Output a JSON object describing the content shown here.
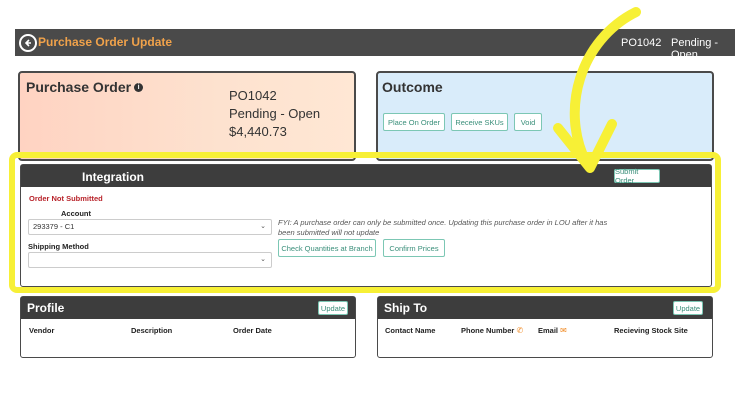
{
  "header": {
    "title": "Purchase Order Update",
    "po_number": "PO1042",
    "status": "Pending - Open"
  },
  "purchase_order": {
    "heading": "Purchase Order",
    "number": "PO1042",
    "status": "Pending - Open",
    "total": "$4,440.73"
  },
  "outcome": {
    "heading": "Outcome",
    "buttons": [
      "Place On Order",
      "Receive SKUs",
      "Void"
    ]
  },
  "integration": {
    "heading": "Integration",
    "submit_label": "Submit Order",
    "status_text": "Order Not Submitted",
    "account_label": "Account",
    "account_value": "293379 - C1",
    "shipping_label": "Shipping Method",
    "shipping_value": "",
    "fyi": "FYI: A purchase order can only be submitted once. Updating this purchase order in LOU after it has been submitted will not update",
    "check_label": "Check Quantities at Branch",
    "confirm_label": "Confirm Prices"
  },
  "profile": {
    "heading": "Profile",
    "update_label": "Update",
    "columns": [
      "Vendor",
      "Description",
      "Order Date"
    ]
  },
  "ship_to": {
    "heading": "Ship To",
    "update_label": "Update",
    "columns": [
      "Contact Name",
      "Phone Number",
      "Email",
      "Recieving Stock Site"
    ]
  },
  "colors": {
    "highlight": "#f7f036",
    "header_bg": "#4a4a4a",
    "title_orange": "#f0a24a",
    "accent_teal": "#3a8f7a",
    "error_red": "#b8232a"
  }
}
